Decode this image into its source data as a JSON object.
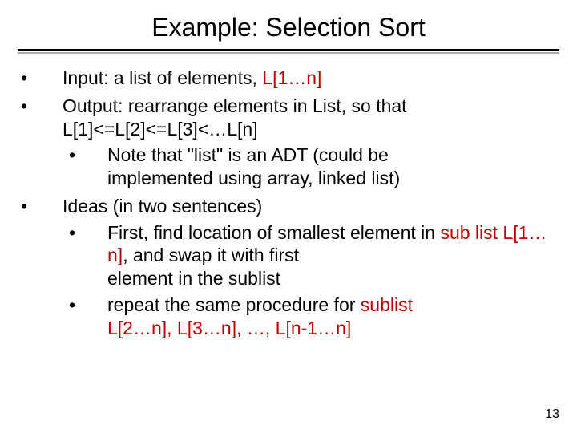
{
  "title": "Example: Selection Sort",
  "b1": {
    "pre": "Input: a list of elements, ",
    "red": "L[1…n]"
  },
  "b2": {
    "l1": "Output: rearrange elements in List, so that",
    "l2": "L[1]<=L[2]<=L[3]<…L[n]"
  },
  "b2a": {
    "l1": "Note that \"list\" is an ADT (could be",
    "l2": "implemented using array, linked list)"
  },
  "b3": "Ideas (in two sentences)",
  "b3a": {
    "l1_pre": "First, find location of smallest element in ",
    "l1_red": "sub list L[1…n]",
    "l1_post": ", and swap it with first",
    "l2": "element in the sublist"
  },
  "b3b": {
    "pre": "repeat the same procedure for ",
    "red": "sublist",
    "l2": "L[2…n], L[3…n], …, L[n-1…n]"
  },
  "page": "13"
}
